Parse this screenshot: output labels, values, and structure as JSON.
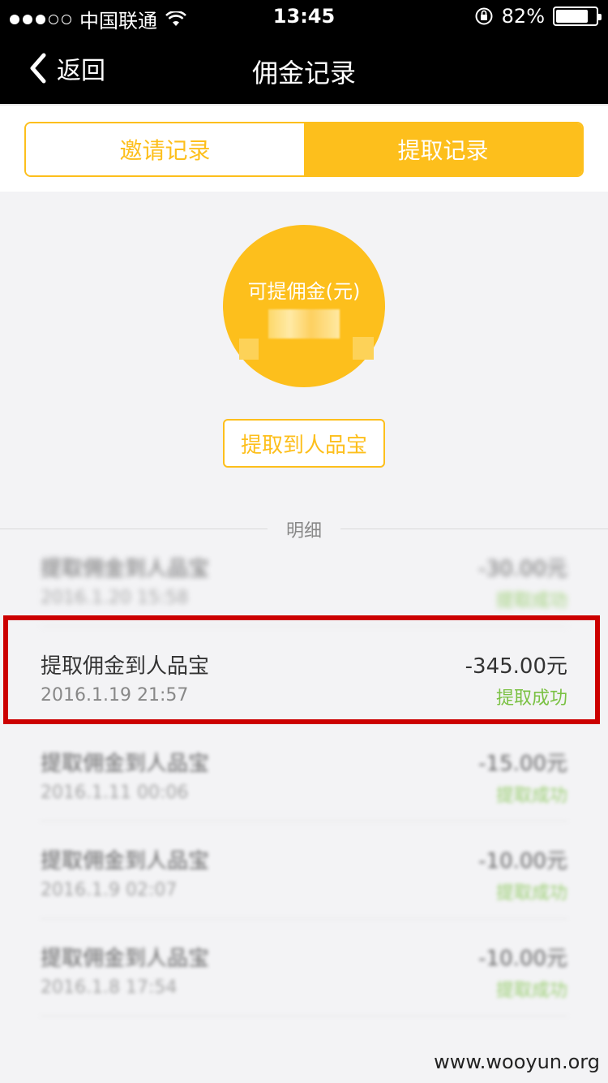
{
  "status_bar": {
    "carrier": "中国联通",
    "time": "13:45",
    "battery_text": "82%",
    "battery_level": 0.82,
    "signal_bars_filled": 3,
    "signal_bars_total": 5
  },
  "nav": {
    "back_label": "返回",
    "title": "佣金记录"
  },
  "tabs": [
    {
      "label": "邀请记录",
      "active": false
    },
    {
      "label": "提取记录",
      "active": true
    }
  ],
  "balance": {
    "label": "可提佣金(元)"
  },
  "withdraw_button": "提取到人品宝",
  "detail_label": "明细",
  "records": [
    {
      "title": "提取佣金到人品宝",
      "time": "2016.1.20 15:58",
      "amount": "-30.00元",
      "status": "提取成功"
    },
    {
      "title": "提取佣金到人品宝",
      "time": "2016.1.19 21:57",
      "amount": "-345.00元",
      "status": "提取成功"
    },
    {
      "title": "提取佣金到人品宝",
      "time": "2016.1.11 00:06",
      "amount": "-15.00元",
      "status": "提取成功"
    },
    {
      "title": "提取佣金到人品宝",
      "time": "2016.1.9 02:07",
      "amount": "-10.00元",
      "status": "提取成功"
    },
    {
      "title": "提取佣金到人品宝",
      "time": "2016.1.8 17:54",
      "amount": "-10.00元",
      "status": "提取成功"
    }
  ],
  "watermark": "www.wooyun.org",
  "colors": {
    "accent": "#fdbf1c",
    "success": "#7ac143",
    "highlight": "#cc0000"
  }
}
